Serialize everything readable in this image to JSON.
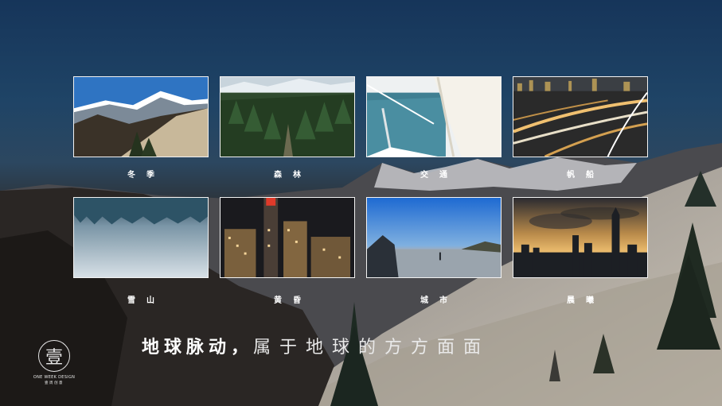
{
  "gallery": {
    "items": [
      {
        "label": "冬季",
        "icon": "mountain-photo"
      },
      {
        "label": "森林",
        "icon": "forest-photo"
      },
      {
        "label": "交通",
        "icon": "sailboat-photo"
      },
      {
        "label": "帆船",
        "icon": "city-night-photo"
      },
      {
        "label": "雪山",
        "icon": "snow-field-photo"
      },
      {
        "label": "黄昏",
        "icon": "skyscraper-night-photo"
      },
      {
        "label": "城市",
        "icon": "sunset-coast-photo"
      },
      {
        "label": "晨曦",
        "icon": "skyline-dawn-photo"
      }
    ]
  },
  "slogan": {
    "strong": "地球脉动，",
    "light": "属于地球的方方面面"
  },
  "logo": {
    "glyph": "壹",
    "name_en": "ONE WEEK DESIGN",
    "name_cn": "壹周创意"
  },
  "colors": {
    "card_border": "#f2f2f2",
    "text": "#ffffff"
  }
}
